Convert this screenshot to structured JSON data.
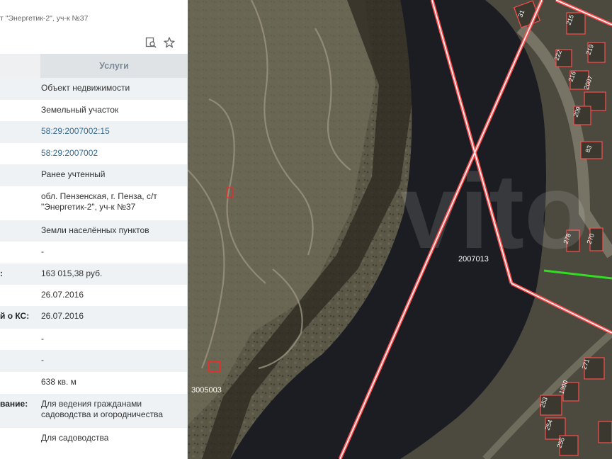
{
  "panel": {
    "subtitle": "т \"Энергетик-2\", уч-к №37",
    "services_tab": "Услуги",
    "rows": [
      {
        "label": "",
        "value": "Объект недвижимости"
      },
      {
        "label": "",
        "value": "Земельный участок"
      },
      {
        "label": "",
        "value": "58:29:2007002:15"
      },
      {
        "label": "",
        "value": "58:29:2007002"
      },
      {
        "label": "",
        "value": "Ранее учтенный"
      },
      {
        "label": "",
        "value": "обл. Пензенская, г. Пенза, с/т \"Энергетик-2\", уч-к №37"
      },
      {
        "label": "",
        "value": "Земли населённых пунктов"
      },
      {
        "label": "",
        "value": "-"
      },
      {
        "label": ":",
        "value": "163 015,38 руб."
      },
      {
        "label": "",
        "value": "26.07.2016"
      },
      {
        "label": "й о КС:",
        "value": "26.07.2016"
      },
      {
        "label": "",
        "value": "-"
      },
      {
        "label": "",
        "value": "-"
      },
      {
        "label": "",
        "value": "638 кв. м"
      },
      {
        "label": "вание:",
        "value": "Для ведения гражданами садоводства и огородничества"
      },
      {
        "label": "",
        "value": "Для садоводства"
      }
    ],
    "icons": [
      "document-search-icon",
      "star-icon"
    ]
  },
  "map": {
    "quarter_labels": [
      "2007013",
      "3005003"
    ],
    "parcel_numbers": [
      "215",
      "219",
      "222",
      "216",
      "2007",
      "209",
      "83",
      "278",
      "270",
      "271",
      "1390",
      "253",
      "254",
      "255",
      "31"
    ],
    "watermark": "vito",
    "colors": {
      "boundary": "#ff4d4d",
      "boundary_inner": "#ffffff",
      "river": "#1b1d22",
      "highlight": "#33dd22"
    }
  }
}
